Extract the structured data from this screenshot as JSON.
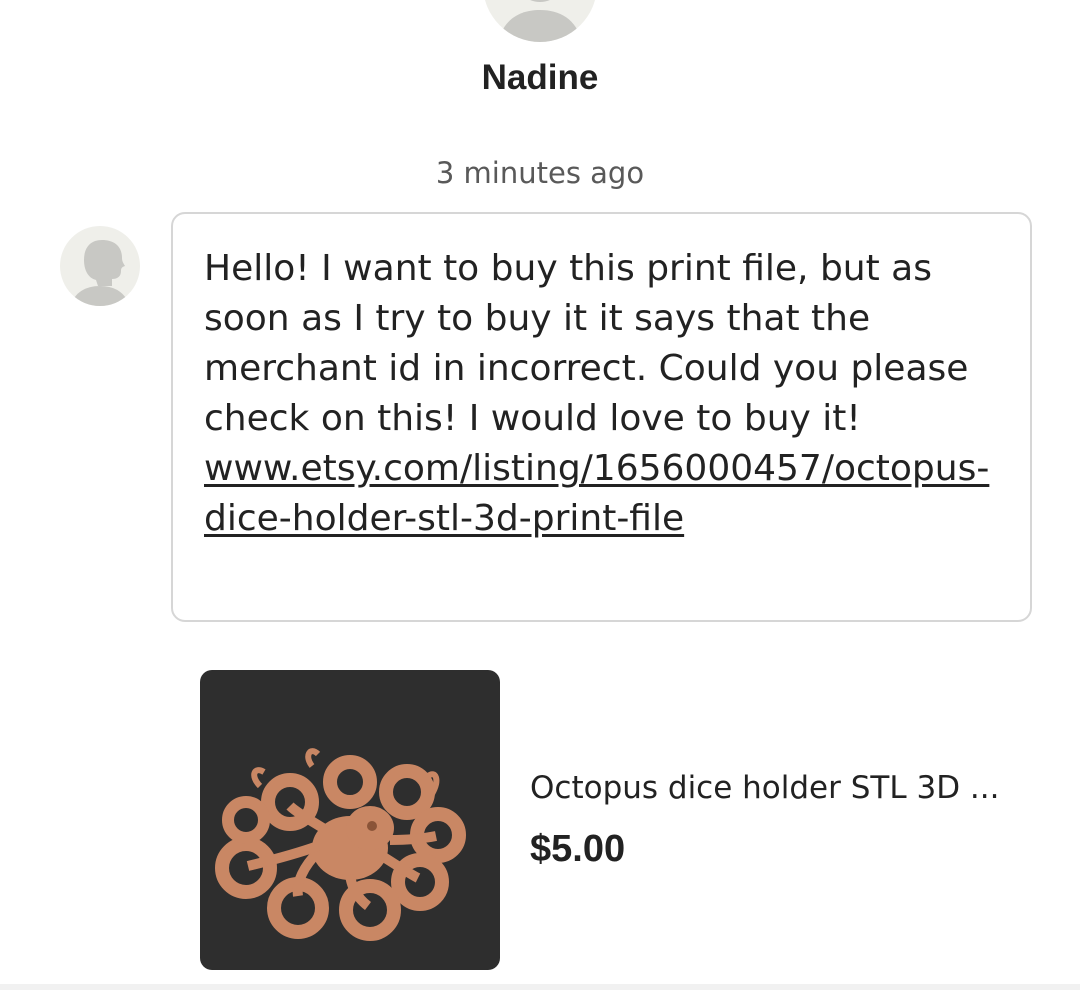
{
  "conversation": {
    "contact_name": "Nadine",
    "timestamp": "3 minutes ago"
  },
  "message": {
    "text": "Hello! I want to buy this print file, but as soon as I try to buy it it says that the merchant id in incorrect. Could you please check on this! I would love to buy it!",
    "link": "www.etsy.com/listing/1656000457/octopus-dice-holder-stl-3d-print-file"
  },
  "listing": {
    "title": "Octopus dice holder STL 3D ...",
    "price": "$5.00",
    "image_icon": "octopus-image"
  },
  "colors": {
    "text": "#222222",
    "muted": "#595959",
    "bubble_border": "#d6d6d6",
    "avatar_bg": "#efefea",
    "avatar_silhouette": "#c8c8c4",
    "image_bg": "#2e2e2e",
    "octopus": "#c98764"
  }
}
